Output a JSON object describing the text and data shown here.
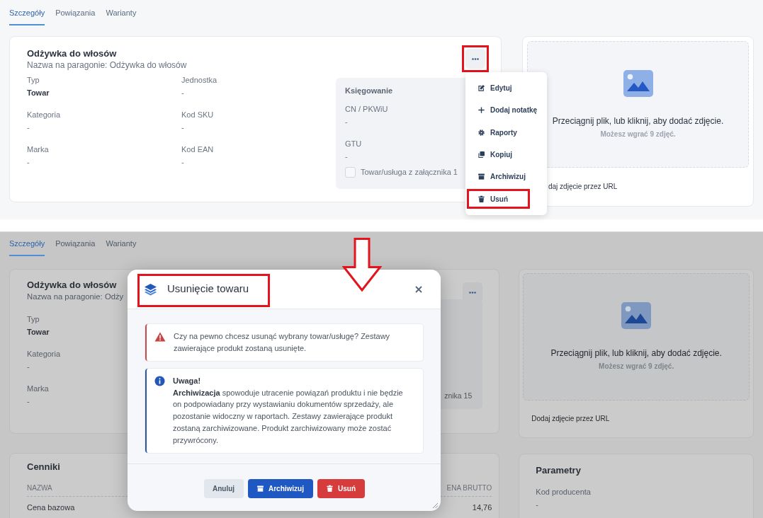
{
  "before": {
    "tabs": [
      {
        "label": "Szczegóły",
        "selected": true
      },
      {
        "label": "Powiązania",
        "selected": false
      },
      {
        "label": "Warianty",
        "selected": false
      }
    ],
    "product": {
      "name": "Odżywka do włosów",
      "receipt_name": "Nazwa na paragonie: Odżywka do włosów"
    },
    "fields": [
      {
        "label": "Typ",
        "value": "Towar"
      },
      {
        "label": "Jednostka",
        "value": "-"
      },
      {
        "label": "Kategoria",
        "value": "-"
      },
      {
        "label": "Kod SKU",
        "value": "-"
      },
      {
        "label": "Marka",
        "value": "-"
      },
      {
        "label": "Kod EAN",
        "value": "-"
      }
    ],
    "accounting": {
      "title": "Księgowanie",
      "fields": [
        {
          "label": "CN / PKWiU",
          "value": "-"
        },
        {
          "label": "GTU",
          "value": "-"
        }
      ],
      "checkbox": {
        "label": "Towar/usługa z załącznika 1",
        "checked": false
      }
    },
    "menu": [
      {
        "kind": "edit",
        "label": "Edytuj"
      },
      {
        "kind": "add",
        "label": "Dodaj notatkę"
      },
      {
        "kind": "gear",
        "label": "Raporty"
      },
      {
        "kind": "copy",
        "label": "Kopiuj"
      },
      {
        "kind": "archive",
        "label": "Archiwizuj"
      },
      {
        "kind": "trash",
        "label": "Usuń"
      }
    ],
    "photo": {
      "prompt": "Przeciągnij plik, lub kliknij, aby dodać zdjęcie.",
      "limit": "Możesz wgrać 9 zdjęć.",
      "url_link": "daj zdjęcie przez URL"
    }
  },
  "after": {
    "tabs": [
      {
        "label": "Szczegóły",
        "selected": true
      },
      {
        "label": "Powiązania",
        "selected": false
      },
      {
        "label": "Warianty",
        "selected": false
      }
    ],
    "product": {
      "name": "Odżywka do włosów",
      "receipt_name": "Nazwa na paragonie: Odży"
    },
    "fields": [
      {
        "label": "Typ",
        "value": "Towar"
      },
      {
        "label": "Kategoria",
        "value": "-"
      },
      {
        "label": "Marka",
        "value": "-"
      }
    ],
    "accounting_fragment": "znika 15",
    "photo": {
      "prompt": "Przeciągnij plik, lub kliknij, aby dodać zdjęcie.",
      "limit": "Możesz wgrać 9 zdjęć.",
      "url_link": "Dodaj zdjęcie przez URL"
    },
    "prices": {
      "title": "Cenniki",
      "columns": [
        "NAZWA",
        "ENA BRUTTO"
      ],
      "rows": [
        [
          "Cena bazowa",
          "14,76"
        ]
      ]
    },
    "parameters": {
      "title": "Parametry",
      "fields": [
        {
          "label": "Kod producenta",
          "value": "-"
        }
      ]
    },
    "dialog": {
      "title": "Usunięcie towaru",
      "alerts": [
        {
          "kind": "warning",
          "text": "Czy na pewno chcesz usunąć wybrany towar/usługę? Zestawy zawierające produkt zostaną usunięte."
        },
        {
          "kind": "info",
          "title": "Uwaga!",
          "text": "**Archiwizacja** spowoduje utracenie powiązań produktu i nie będzie on podpowiadany przy wystawianiu dokumentów sprzedaży, ale pozostanie widoczny w raportach. Zestawy zawierające produkt zostaną zarchiwizowane. Produkt zarchiwizowany może zostać przywrócony."
        }
      ],
      "buttons": [
        {
          "kind": "cancel",
          "label": "Anuluj"
        },
        {
          "kind": "archive",
          "label": "Archiwizuj"
        },
        {
          "kind": "delete",
          "label": "Usuń"
        }
      ]
    }
  }
}
